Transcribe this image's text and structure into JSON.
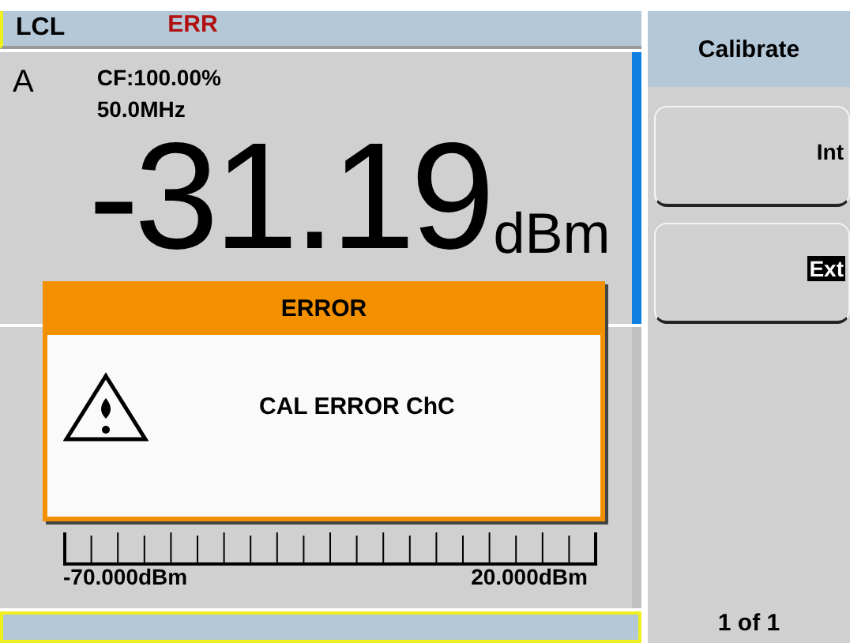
{
  "status_bar": {
    "mode": "LCL",
    "error": "ERR"
  },
  "measurement": {
    "channel": "A",
    "cal_factor": "CF:100.00%",
    "frequency": "50.0MHz",
    "reading": "-31.19",
    "unit": "dBm"
  },
  "scale": {
    "min": "-70.000dBm",
    "max": "20.000dBm"
  },
  "dialog": {
    "title": "ERROR",
    "message": "CAL ERROR ChC"
  },
  "softkeys": {
    "title": "Calibrate",
    "items": [
      {
        "label": "Int",
        "selected": false
      },
      {
        "label": "Ext",
        "selected": true
      }
    ],
    "page": "1 of 1"
  }
}
